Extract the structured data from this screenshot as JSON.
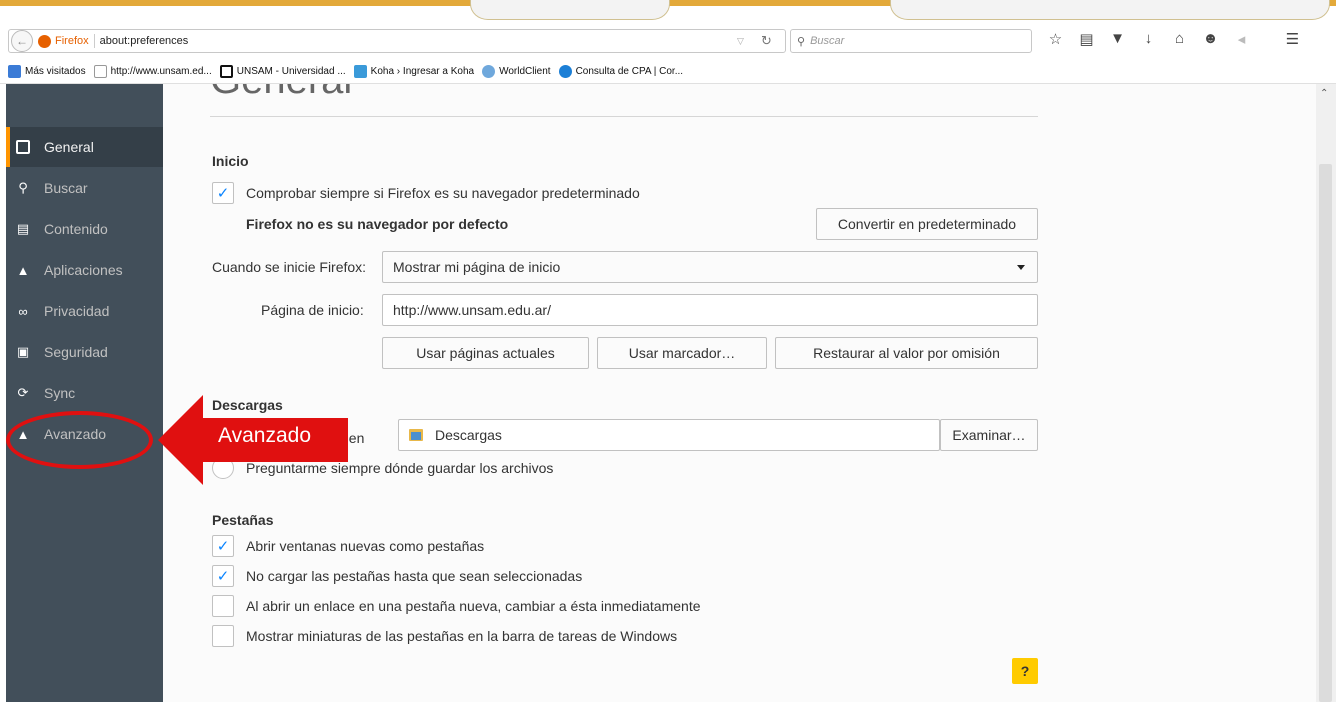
{
  "browser": {
    "identity_label": "Firefox",
    "url": "about:preferences",
    "search_placeholder": "Buscar"
  },
  "bookmarks": [
    {
      "label": "Más visitados",
      "icon": "most-visited-icon",
      "color": "#3b7bd6"
    },
    {
      "label": "http://www.unsam.ed...",
      "icon": "page-icon",
      "color": "#ffffff"
    },
    {
      "label": "UNSAM - Universidad ...",
      "icon": "unsam-icon",
      "color": "#111111"
    },
    {
      "label": "Koha › Ingresar a Koha",
      "icon": "koha-icon",
      "color": "#3a9ad9"
    },
    {
      "label": "WorldClient",
      "icon": "worldclient-icon",
      "color": "#6fa8dc"
    },
    {
      "label": "Consulta de CPA | Cor...",
      "icon": "cpa-icon",
      "color": "#1c7fd6"
    }
  ],
  "sidebar": {
    "items": [
      {
        "label": "General",
        "icon": "general-icon",
        "active": true
      },
      {
        "label": "Buscar",
        "icon": "search-icon",
        "active": false
      },
      {
        "label": "Contenido",
        "icon": "content-icon",
        "active": false
      },
      {
        "label": "Aplicaciones",
        "icon": "applications-icon",
        "active": false
      },
      {
        "label": "Privacidad",
        "icon": "privacy-mask-icon",
        "active": false
      },
      {
        "label": "Seguridad",
        "icon": "security-lock-icon",
        "active": false
      },
      {
        "label": "Sync",
        "icon": "sync-icon",
        "active": false
      },
      {
        "label": "Avanzado",
        "icon": "advanced-wizard-icon",
        "active": false
      }
    ]
  },
  "page": {
    "title": "General",
    "inicio": {
      "heading": "Inicio",
      "check_default_label": "Comprobar siempre si Firefox es su navegador predeterminado",
      "check_default_checked": true,
      "not_default_text": "Firefox no es su navegador por defecto",
      "make_default_button": "Convertir en predeterminado",
      "startup_label": "Cuando se inicie Firefox:",
      "startup_value": "Mostrar mi página de inicio",
      "homepage_label": "Página de inicio:",
      "homepage_value": "http://www.unsam.edu.ar/",
      "use_current_button": "Usar páginas actuales",
      "use_bookmark_button": "Usar marcador…",
      "restore_default_button": "Restaurar al valor por omisión"
    },
    "descargas": {
      "heading": "Descargas",
      "save_to_label_partial": "ivos en",
      "folder_value": "Descargas",
      "browse_button": "Examinar…",
      "always_ask_label": "Preguntarme siempre dónde guardar los archivos"
    },
    "pestanas": {
      "heading": "Pestañas",
      "options": [
        {
          "label": "Abrir ventanas nuevas como pestañas",
          "checked": true
        },
        {
          "label": "No cargar las pestañas hasta que sean seleccionadas",
          "checked": true
        },
        {
          "label": "Al abrir un enlace en una pestaña nueva, cambiar a ésta inmediatamente",
          "checked": false
        },
        {
          "label": "Mostrar miniaturas de las pestañas en la barra de tareas de Windows",
          "checked": false
        }
      ]
    },
    "help_button": "?"
  },
  "annotation": {
    "arrow_label": "Avanzado",
    "color": "#e01010"
  },
  "colors": {
    "sidebar_bg": "#424f5a",
    "sidebar_active_bg": "#343f48",
    "accent_orange": "#ff9500",
    "checkbox_blue": "#0a84ff"
  }
}
